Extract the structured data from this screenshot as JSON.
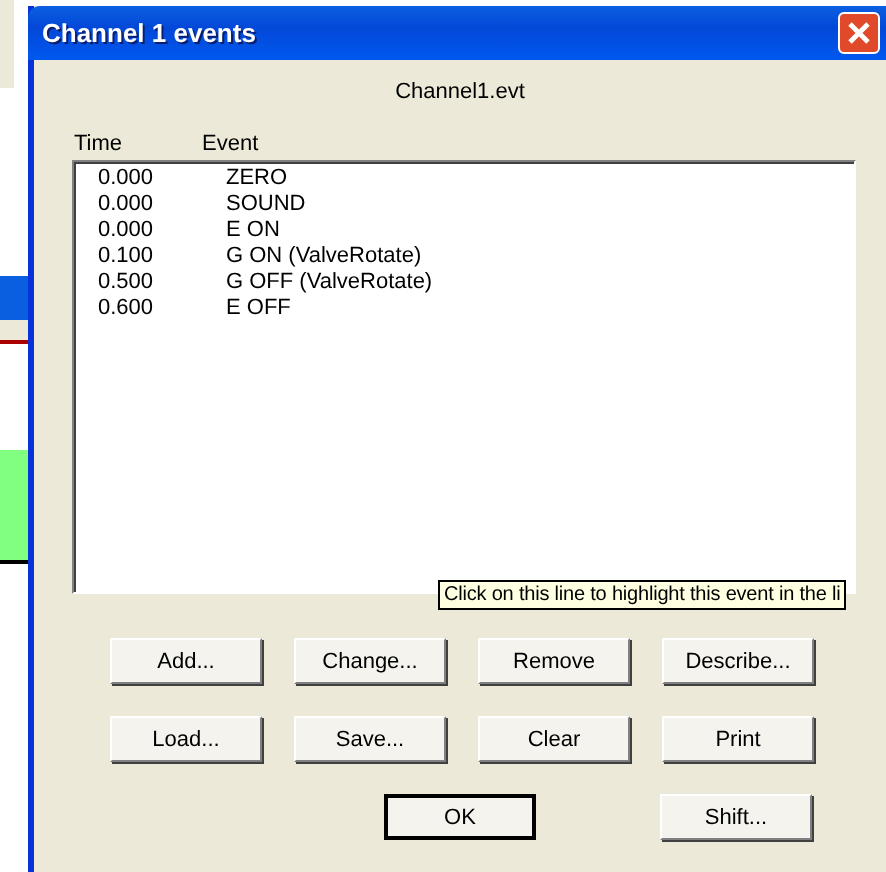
{
  "window": {
    "title": "Channel 1 events"
  },
  "file_name": "Channel1.evt",
  "columns": [
    "Time",
    "Event"
  ],
  "events": [
    {
      "time": "0.000",
      "event": "ZERO"
    },
    {
      "time": "0.000",
      "event": "SOUND"
    },
    {
      "time": "0.000",
      "event": "E ON"
    },
    {
      "time": "0.100",
      "event": "G ON (ValveRotate)"
    },
    {
      "time": "0.500",
      "event": "G OFF (ValveRotate)"
    },
    {
      "time": "0.600",
      "event": "E OFF"
    }
  ],
  "tooltip": "Click on this line to highlight this event in the li",
  "button_rows": [
    [
      {
        "label": "Add...",
        "default": false
      },
      {
        "label": "Change...",
        "default": false
      },
      {
        "label": "Remove",
        "default": false
      },
      {
        "label": "Describe...",
        "default": false
      }
    ],
    [
      {
        "label": "Load...",
        "default": false
      },
      {
        "label": "Save...",
        "default": false
      },
      {
        "label": "Clear",
        "default": false
      },
      {
        "label": "Print",
        "default": false
      }
    ],
    [
      {
        "label": "OK",
        "default": true
      },
      {
        "label": "Shift...",
        "default": false
      }
    ]
  ]
}
